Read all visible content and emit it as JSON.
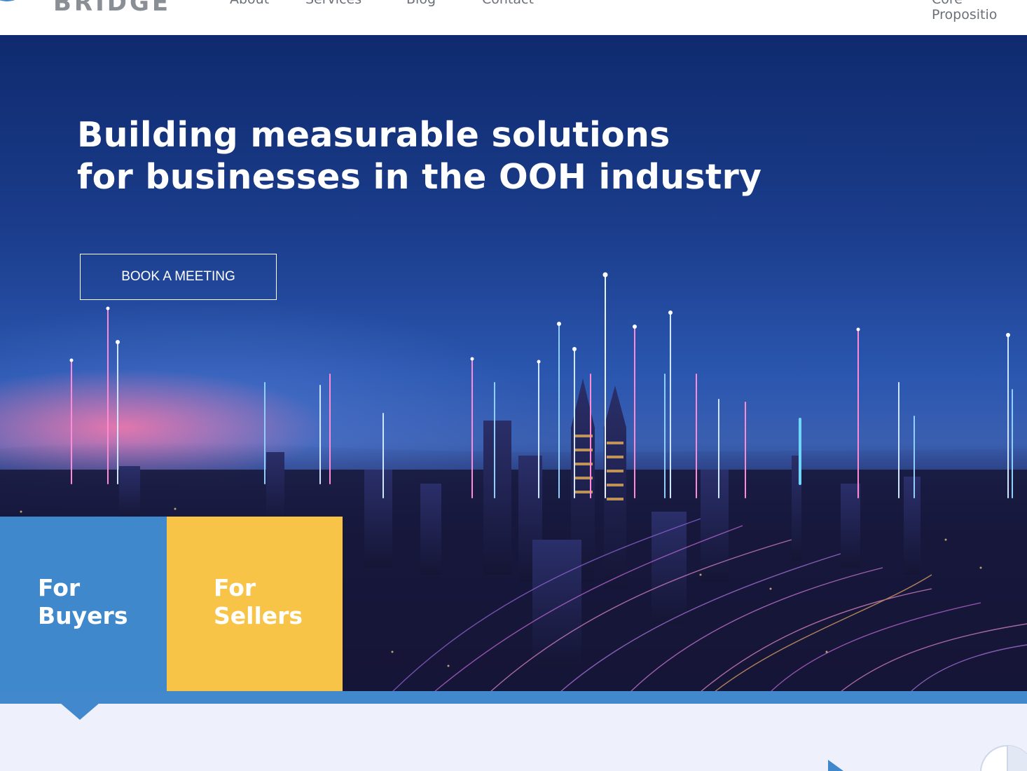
{
  "header": {
    "logo_text": "BRIDGE",
    "nav": {
      "about": "About",
      "services": "Services",
      "blog": "Blog",
      "contact": "Contact",
      "core": "Core Propositio"
    }
  },
  "hero": {
    "title_line1": "Building measurable solutions",
    "title_line2": "for businesses in the OOH industry",
    "cta_label": "BOOK A MEETING"
  },
  "tiles": {
    "buyers_line1": "For",
    "buyers_line2": "Buyers",
    "sellers_line1": "For",
    "sellers_line2": "Sellers"
  },
  "colors": {
    "buyers_tile": "#3f88cc",
    "sellers_tile": "#f8c448",
    "band": "#4288cc",
    "lower_bg": "#eef0fb"
  },
  "icons": {
    "logo": "bridge-logo-icon",
    "play": "play-icon",
    "pie": "pie-chart-icon"
  }
}
